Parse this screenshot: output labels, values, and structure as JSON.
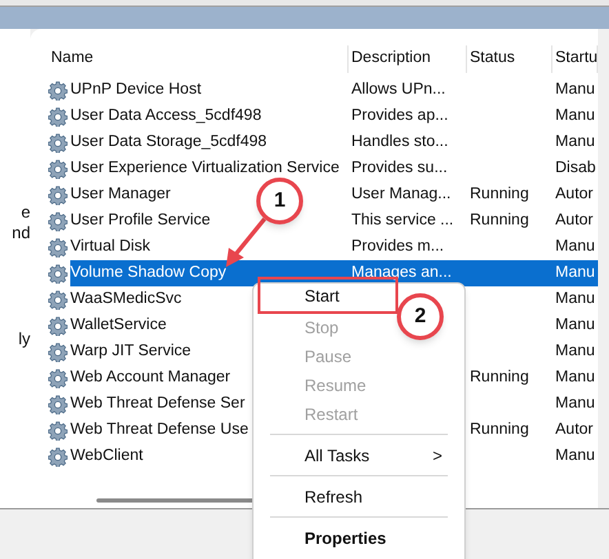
{
  "left_pane": {
    "fragments": [
      "e",
      "nd",
      "ly"
    ]
  },
  "table": {
    "columns": [
      "Name",
      "Description",
      "Status",
      "Startu"
    ],
    "rows": [
      {
        "name": "UPnP Device Host",
        "description": "Allows UPn...",
        "startup": "Manu",
        "selected": false
      },
      {
        "name": "User Data Access_5cdf498",
        "description": "Provides ap...",
        "startup": "Manu",
        "selected": false
      },
      {
        "name": "User Data Storage_5cdf498",
        "description": "Handles sto...",
        "startup": "Manu",
        "selected": false
      },
      {
        "name": "User Experience Virtualization Service",
        "description": "Provides su...",
        "startup": "Disab",
        "selected": false
      },
      {
        "name": "User Manager",
        "description": "User Manag...",
        "status": "Running",
        "startup": "Autor",
        "selected": false
      },
      {
        "name": "User Profile Service",
        "description": "This service ...",
        "status": "Running",
        "startup": "Autor",
        "selected": false
      },
      {
        "name": "Virtual Disk",
        "description": "Provides m...",
        "startup": "Manu",
        "selected": false
      },
      {
        "name": "Volume Shadow Copy",
        "description": "Manages an...",
        "startup": "Manu",
        "selected": true
      },
      {
        "name": "WaaSMedicSvc",
        "startup": "Manu",
        "selected": false
      },
      {
        "name": "WalletService",
        "startup": "Manu",
        "selected": false
      },
      {
        "name": "Warp JIT Service",
        "startup": "Manu",
        "selected": false
      },
      {
        "name": "Web Account Manager",
        "status": "Running",
        "startup": "Manu",
        "selected": false
      },
      {
        "name": "Web Threat Defense Ser",
        "startup": "Manu",
        "selected": false
      },
      {
        "name": "Web Threat Defense Use",
        "status": "Running",
        "startup": "Autor",
        "selected": false
      },
      {
        "name": "WebClient",
        "startup": "Manu",
        "selected": false
      }
    ]
  },
  "context_menu": {
    "items": [
      {
        "kind": "item",
        "label": "Start",
        "disabled": false,
        "highlighted": true
      },
      {
        "kind": "item",
        "label": "Stop",
        "disabled": true,
        "highlighted": false
      },
      {
        "kind": "item",
        "label": "Pause",
        "disabled": true,
        "highlighted": false
      },
      {
        "kind": "item",
        "label": "Resume",
        "disabled": true,
        "highlighted": false
      },
      {
        "kind": "item",
        "label": "Restart",
        "disabled": true,
        "highlighted": false
      },
      {
        "kind": "separator"
      },
      {
        "kind": "submenu",
        "label": "All Tasks",
        "caret": ">",
        "disabled": false,
        "highlighted": false
      },
      {
        "kind": "separator"
      },
      {
        "kind": "item",
        "label": "Refresh",
        "disabled": false,
        "highlighted": false
      },
      {
        "kind": "separator"
      },
      {
        "kind": "default",
        "label": "Properties",
        "disabled": false,
        "highlighted": false
      }
    ]
  },
  "callouts": [
    {
      "label": "1"
    },
    {
      "label": "2"
    }
  ]
}
